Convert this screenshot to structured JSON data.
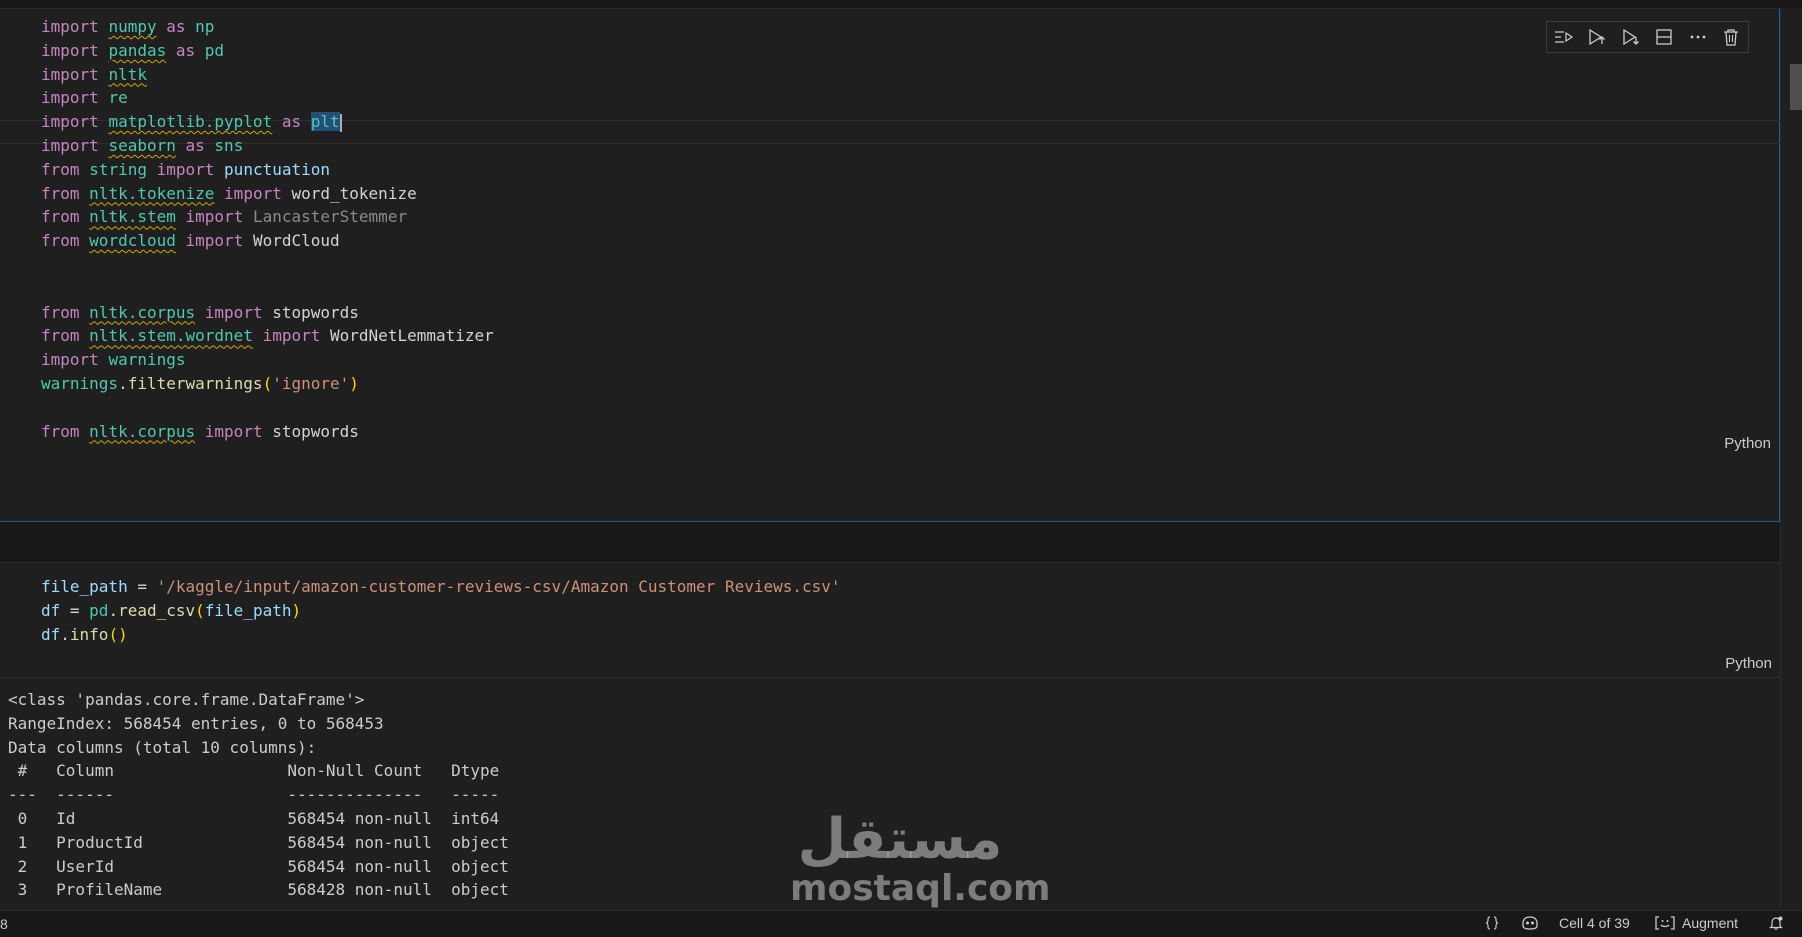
{
  "cell1": {
    "language": "Python",
    "lines": [
      [
        [
          "import",
          "kw"
        ],
        [
          " ",
          "plain"
        ],
        [
          "numpy",
          "mod squig"
        ],
        [
          " ",
          "plain"
        ],
        [
          "as",
          "kw"
        ],
        [
          " ",
          "plain"
        ],
        [
          "np",
          "mod"
        ]
      ],
      [
        [
          "import",
          "kw"
        ],
        [
          " ",
          "plain"
        ],
        [
          "pandas",
          "mod squig"
        ],
        [
          " ",
          "plain"
        ],
        [
          "as",
          "kw"
        ],
        [
          " ",
          "plain"
        ],
        [
          "pd",
          "mod"
        ]
      ],
      [
        [
          "import",
          "kw"
        ],
        [
          " ",
          "plain"
        ],
        [
          "nltk",
          "mod squig"
        ]
      ],
      [
        [
          "import",
          "kw"
        ],
        [
          " ",
          "plain"
        ],
        [
          "re",
          "mod"
        ]
      ],
      [
        [
          "import",
          "kw"
        ],
        [
          " ",
          "plain"
        ],
        [
          "matplotlib.pyplot",
          "mod squig"
        ],
        [
          " ",
          "plain"
        ],
        [
          "as",
          "kw"
        ],
        [
          " ",
          "plain"
        ],
        [
          "plt",
          "mod hl"
        ]
      ],
      [
        [
          "import",
          "kw"
        ],
        [
          " ",
          "plain"
        ],
        [
          "seaborn",
          "mod squig"
        ],
        [
          " ",
          "plain"
        ],
        [
          "as",
          "kw"
        ],
        [
          " ",
          "plain"
        ],
        [
          "sns",
          "mod"
        ]
      ],
      [
        [
          "from",
          "kw"
        ],
        [
          " ",
          "plain"
        ],
        [
          "string",
          "mod"
        ],
        [
          " ",
          "plain"
        ],
        [
          "import",
          "kw"
        ],
        [
          " ",
          "plain"
        ],
        [
          "punctuation",
          "var"
        ]
      ],
      [
        [
          "from",
          "kw"
        ],
        [
          " ",
          "plain"
        ],
        [
          "nltk.tokenize",
          "mod squig"
        ],
        [
          " ",
          "plain"
        ],
        [
          "import",
          "kw"
        ],
        [
          " ",
          "plain"
        ],
        [
          "word_tokenize",
          "plain"
        ]
      ],
      [
        [
          "from",
          "kw"
        ],
        [
          " ",
          "plain"
        ],
        [
          "nltk.stem",
          "mod squig"
        ],
        [
          " ",
          "plain"
        ],
        [
          "import",
          "kw"
        ],
        [
          " ",
          "plain"
        ],
        [
          "LancasterStemmer",
          "dim"
        ]
      ],
      [
        [
          "from",
          "kw"
        ],
        [
          " ",
          "plain"
        ],
        [
          "wordcloud",
          "mod squig"
        ],
        [
          " ",
          "plain"
        ],
        [
          "import",
          "kw"
        ],
        [
          " ",
          "plain"
        ],
        [
          "WordCloud",
          "plain"
        ]
      ],
      [],
      [],
      [
        [
          "from",
          "kw"
        ],
        [
          " ",
          "plain"
        ],
        [
          "nltk.corpus",
          "mod squig"
        ],
        [
          " ",
          "plain"
        ],
        [
          "import",
          "kw"
        ],
        [
          " ",
          "plain"
        ],
        [
          "stopwords",
          "plain"
        ]
      ],
      [
        [
          "from",
          "kw"
        ],
        [
          " ",
          "plain"
        ],
        [
          "nltk.stem.wordnet",
          "mod squig"
        ],
        [
          " ",
          "plain"
        ],
        [
          "import",
          "kw"
        ],
        [
          " ",
          "plain"
        ],
        [
          "WordNetLemmatizer",
          "plain"
        ]
      ],
      [
        [
          "import",
          "kw"
        ],
        [
          " ",
          "plain"
        ],
        [
          "warnings",
          "mod"
        ]
      ],
      [
        [
          "warnings",
          "mod"
        ],
        [
          ".",
          "plain"
        ],
        [
          "filterwarnings",
          "fn"
        ],
        [
          "(",
          "paren"
        ],
        [
          "'ignore'",
          "str"
        ],
        [
          ")",
          "paren"
        ]
      ],
      [],
      [
        [
          "from",
          "kw"
        ],
        [
          " ",
          "plain"
        ],
        [
          "nltk.corpus",
          "mod squig"
        ],
        [
          " ",
          "plain"
        ],
        [
          "import",
          "kw"
        ],
        [
          " ",
          "plain"
        ],
        [
          "stopwords",
          "plain"
        ]
      ]
    ]
  },
  "cell2": {
    "language": "Python",
    "lines": [
      [
        [
          "file_path",
          "var"
        ],
        [
          " = ",
          "plain"
        ],
        [
          "'/kaggle/input/amazon-customer-reviews-csv/Amazon Customer Reviews.csv'",
          "str"
        ]
      ],
      [
        [
          "df",
          "var"
        ],
        [
          " = ",
          "plain"
        ],
        [
          "pd",
          "mod"
        ],
        [
          ".",
          "plain"
        ],
        [
          "read_csv",
          "fn"
        ],
        [
          "(",
          "paren"
        ],
        [
          "file_path",
          "var"
        ],
        [
          ")",
          "paren"
        ]
      ],
      [
        [
          "df",
          "var"
        ],
        [
          ".",
          "plain"
        ],
        [
          "info",
          "fn"
        ],
        [
          "()",
          "paren"
        ]
      ]
    ]
  },
  "output": {
    "lines": [
      "<class 'pandas.core.frame.DataFrame'>",
      "RangeIndex: 568454 entries, 0 to 568453",
      "Data columns (total 10 columns):",
      " #   Column                  Non-Null Count   Dtype ",
      "---  ------                  --------------   ----- ",
      " 0   Id                      568454 non-null  int64 ",
      " 1   ProductId               568454 non-null  object",
      " 2   UserId                  568454 non-null  object",
      " 3   ProfileName             568428 non-null  object"
    ]
  },
  "toolbar": {
    "buttons": [
      "execute-above-icon",
      "run-above-icon",
      "run-below-icon",
      "split-cell-icon",
      "more-icon",
      "delete-icon"
    ]
  },
  "watermark": {
    "arabic": "مستقل",
    "latin": "mostaql.com"
  },
  "statusbar": {
    "left_fragment": "8",
    "cell_position": "Cell 4 of 39",
    "augment_label": "Augment"
  }
}
